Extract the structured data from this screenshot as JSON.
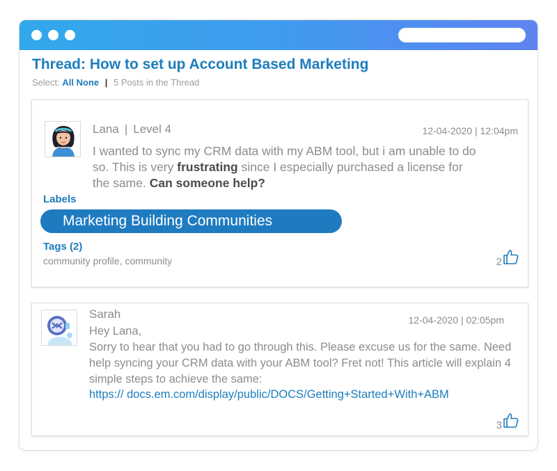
{
  "thread": {
    "title": "Thread: How to set up Account Based Marketing",
    "select_label": "Select:",
    "select_all": "All",
    "select_none": "None",
    "separator": "|",
    "post_count": "5 Posts in the Thread"
  },
  "posts": [
    {
      "author": "Lana",
      "level": "Level 4",
      "timestamp": "12-04-2020 | 12:04pm",
      "body": {
        "part1": "I wanted to sync my CRM data with my ABM tool, but i am unable to do so. This is very ",
        "bold1": "frustrating",
        "part2": " since I especially purchased a license for the same. ",
        "bold2": "Can someone help?"
      },
      "labels_title": "Labels",
      "label": "Marketing Building Communities",
      "tags_title": "Tags (2)",
      "tags": "community profile, community",
      "likes": "2",
      "avatar_icon": "woman-avatar-icon"
    },
    {
      "author": "Sarah",
      "timestamp": "12-04-2020 | 02:05pm",
      "greeting": "Hey Lana,",
      "body": "Sorry to hear that you had to go through this. Please excuse us for the same. Need help syncing your CRM data with your ABM tool? Fret not! This article will explain 4 simple steps to achieve the same:",
      "link": "https:// docs.em.com/display/public/DOCS/Getting+Started+With+ABM",
      "likes": "3",
      "avatar_icon": "robot-avatar-icon"
    }
  ],
  "colors": {
    "accent": "#1c7dbd",
    "pill": "#1f7bc0",
    "titlebar_start": "#32a8ec",
    "titlebar_end": "#5f83f0"
  }
}
